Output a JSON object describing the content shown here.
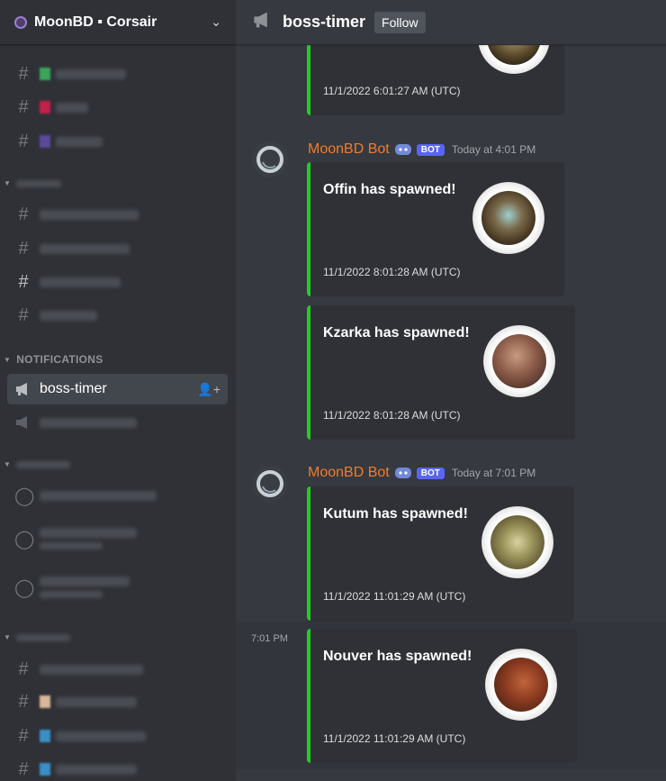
{
  "server": {
    "name": "MoonBD ▪ Corsair"
  },
  "sidebar": {
    "categories": [
      {
        "label": "NOTIFICATIONS"
      }
    ],
    "active_channel": "boss-timer"
  },
  "channel": {
    "name": "boss-timer",
    "follow_label": "Follow"
  },
  "messages": [
    {
      "author": "MoonBD Bot",
      "bot_tag": "BOT",
      "time": "Today at 4:01 PM",
      "embeds": [
        {
          "title": "Offin has spawned!",
          "footer": "11/1/2022 8:01:28 AM (UTC)"
        },
        {
          "title": "Kzarka has spawned!",
          "footer": "11/1/2022 8:01:28 AM (UTC)"
        }
      ]
    },
    {
      "author": "MoonBD Bot",
      "bot_tag": "BOT",
      "time": "Today at 7:01 PM",
      "embeds": [
        {
          "title": "Kutum has spawned!",
          "footer": "11/1/2022 11:01:29 AM (UTC)"
        },
        {
          "title": "Nouver has spawned!",
          "footer": "11/1/2022 11:01:29 AM (UTC)",
          "hover_time": "7:01 PM"
        }
      ]
    }
  ],
  "previous_embed": {
    "footer": "11/1/2022 6:01:27 AM (UTC)"
  },
  "colors": {
    "embed_accent": "#1ed01e",
    "author": "#f27b2a",
    "bot_badge": "#5865f2"
  }
}
